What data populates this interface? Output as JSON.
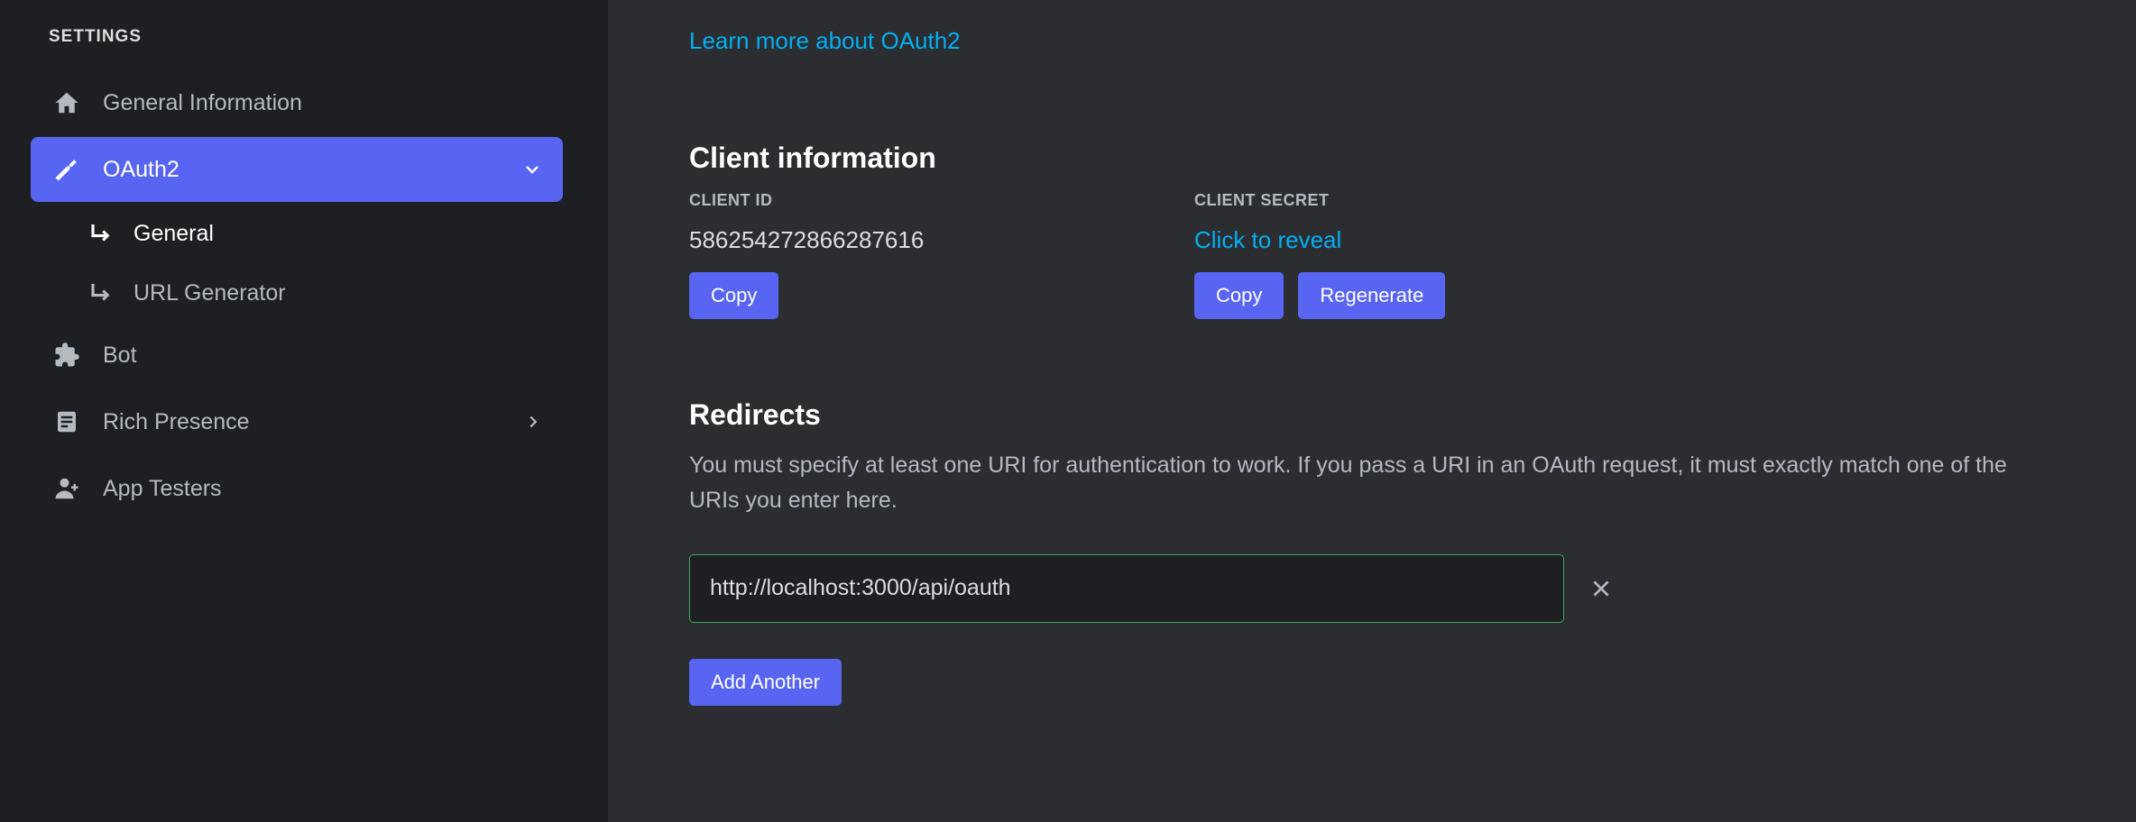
{
  "sidebar": {
    "heading": "SETTINGS",
    "items": {
      "general_info": "General Information",
      "oauth2": "OAuth2",
      "oauth2_general": "General",
      "oauth2_url_gen": "URL Generator",
      "bot": "Bot",
      "rich_presence": "Rich Presence",
      "app_testers": "App Testers"
    }
  },
  "main": {
    "learn_more": "Learn more about OAuth2",
    "client_info_title": "Client information",
    "client_id_label": "CLIENT ID",
    "client_id_value": "586254272866287616",
    "client_secret_label": "CLIENT SECRET",
    "client_secret_reveal": "Click to reveal",
    "copy_btn": "Copy",
    "regenerate_btn": "Regenerate",
    "redirects_title": "Redirects",
    "redirects_desc": "You must specify at least one URI for authentication to work. If you pass a URI in an OAuth request, it must exactly match one of the URIs you enter here.",
    "redirect_value": "http://localhost:3000/api/oauth",
    "add_another_btn": "Add Another"
  }
}
